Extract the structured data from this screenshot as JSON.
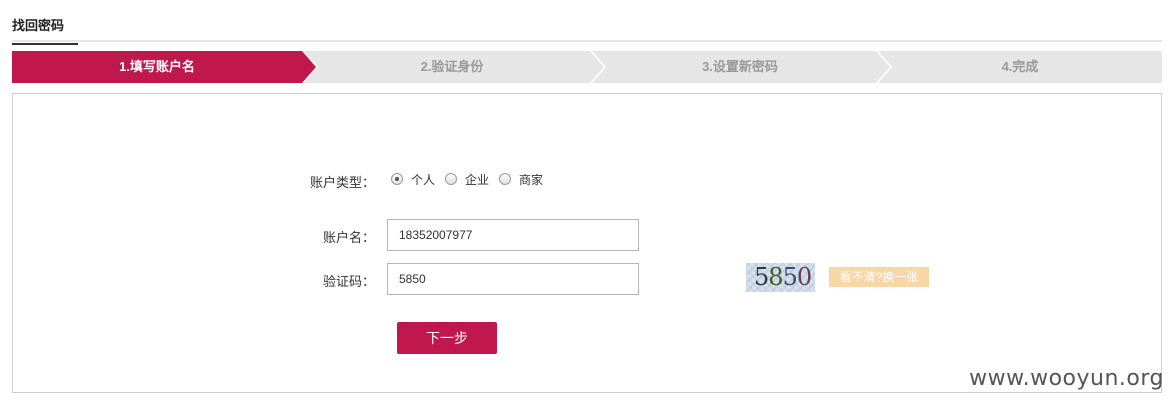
{
  "header": {
    "title": "找回密码"
  },
  "steps": [
    {
      "label": "1.填写账户名",
      "active": true
    },
    {
      "label": "2.验证身份",
      "active": false
    },
    {
      "label": "3.设置新密码",
      "active": false
    },
    {
      "label": "4.完成",
      "active": false
    }
  ],
  "colors": {
    "accent": "#c0184d",
    "step_inactive": "#e6e6e6",
    "captcha_refresh_bg": "#f9d6a6"
  },
  "form": {
    "account_type_label": "账户类型：",
    "account_types": [
      {
        "label": "个人",
        "checked": true
      },
      {
        "label": "企业",
        "checked": false
      },
      {
        "label": "商家",
        "checked": false
      }
    ],
    "account_name_label": "账户名：",
    "account_name_value": "18352007977",
    "captcha_label": "验证码：",
    "captcha_value": "5850",
    "captcha_image_text": "5850",
    "refresh_link": "看不清?换一张",
    "next_button": "下一步"
  },
  "watermark": "www.wooyun.org"
}
